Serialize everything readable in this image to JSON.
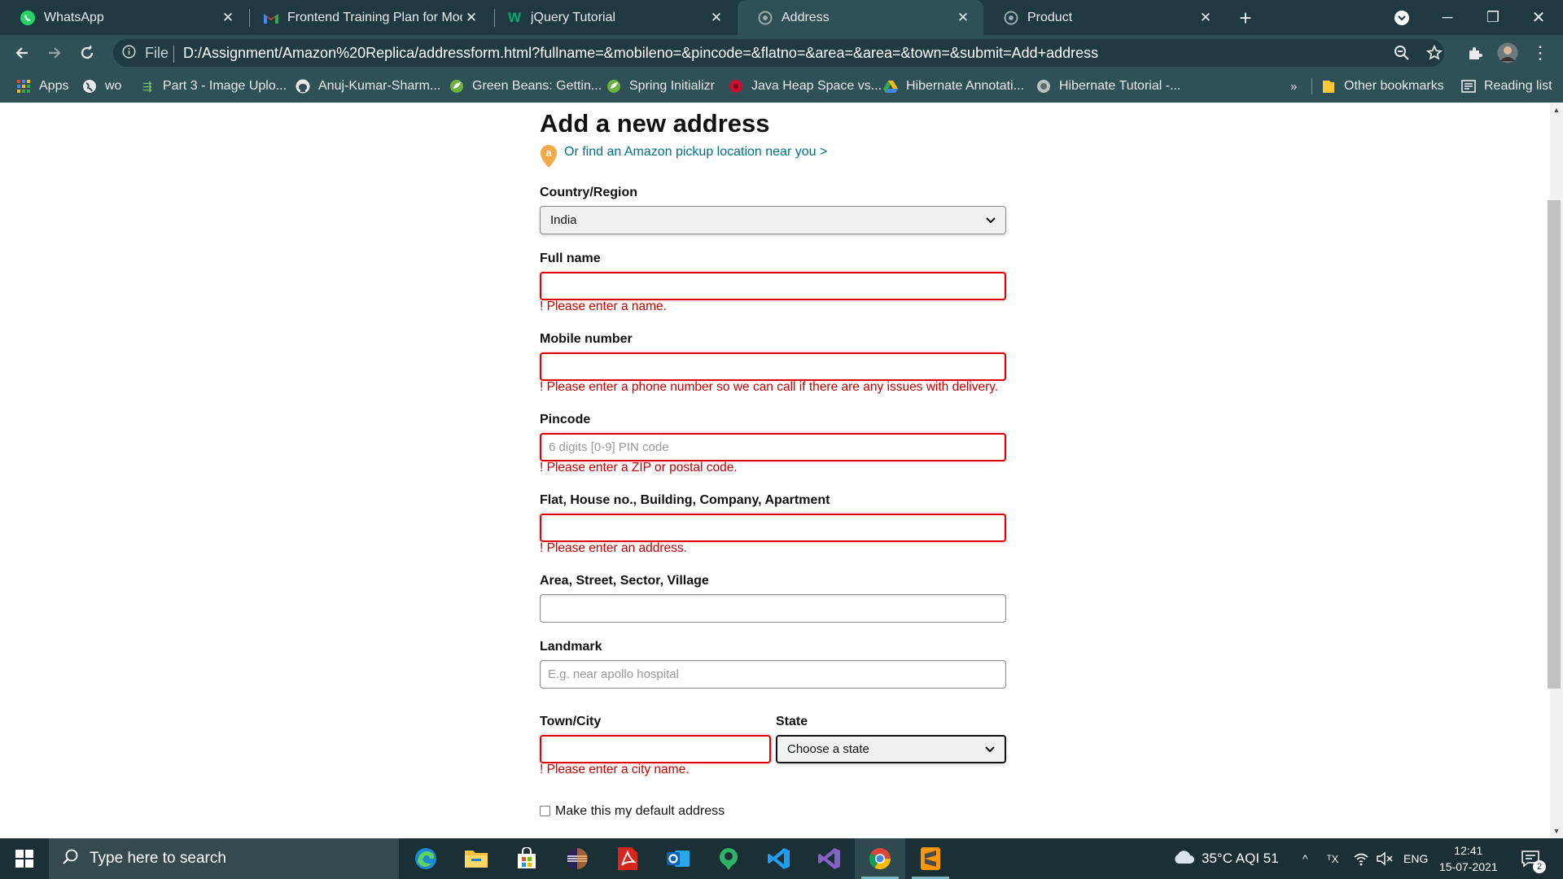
{
  "browser": {
    "tabs": [
      {
        "title": "WhatsApp",
        "icon": "whatsapp-icon"
      },
      {
        "title": "Frontend Training Plan for Modul",
        "icon": "gmail-icon"
      },
      {
        "title": "jQuery Tutorial",
        "icon": "w3schools-icon"
      },
      {
        "title": "Address",
        "icon": "page-icon",
        "active": true
      },
      {
        "title": "Product",
        "icon": "page-icon"
      }
    ],
    "url_scheme_label": "File",
    "url": "D:/Assignment/Amazon%20Replica/addressform.html?fullname=&mobileno=&pincode=&flatno=&area=&area=&town=&submit=Add+address",
    "bookmarks": [
      {
        "label": "Apps",
        "icon": "apps-grid-icon"
      },
      {
        "label": "wo",
        "icon": "globe-icon"
      },
      {
        "label": "Part 3 - Image Uplo...",
        "icon": "doc-icon"
      },
      {
        "label": "Anuj-Kumar-Sharm...",
        "icon": "github-icon"
      },
      {
        "label": "Green Beans: Gettin...",
        "icon": "spring-icon"
      },
      {
        "label": "Spring Initializr",
        "icon": "spring-icon"
      },
      {
        "label": "Java Heap Space vs...",
        "icon": "red-circle-icon"
      },
      {
        "label": "Hibernate Annotati...",
        "icon": "drive-icon"
      },
      {
        "label": "Hibernate Tutorial -...",
        "icon": "globe-icon"
      }
    ],
    "more_bookmarks": "»",
    "other_bookmarks": "Other bookmarks",
    "reading_list": "Reading list"
  },
  "page": {
    "title": "Add a new address",
    "pickup_link": "Or find an Amazon pickup location near you >",
    "country_label": "Country/Region",
    "country_value": "India",
    "fullname_label": "Full name",
    "fullname_value": "",
    "fullname_error": "! Please enter a name.",
    "mobile_label": "Mobile number",
    "mobile_value": "",
    "mobile_error": "! Please enter a phone number so we can call if there are any issues with delivery.",
    "pincode_label": "Pincode",
    "pincode_placeholder": "6 digits [0-9] PIN code",
    "pincode_error": "! Please enter a ZIP or postal code.",
    "flat_label": "Flat, House no., Building, Company, Apartment",
    "flat_value": "",
    "flat_error": "! Please enter an address.",
    "area_label": "Area, Street, Sector, Village",
    "area_value": "",
    "landmark_label": "Landmark",
    "landmark_placeholder": "E.g. near apollo hospital",
    "town_label": "Town/City",
    "town_value": "",
    "town_error": "! Please enter a city name.",
    "state_label": "State",
    "state_value": "Choose a state",
    "default_checkbox_label": "Make this my default address",
    "default_checked": false
  },
  "taskbar": {
    "search_placeholder": "Type here to search",
    "weather": "35°C  AQI 51",
    "language": "ENG",
    "time": "12:41",
    "date": "15-07-2021",
    "notification_count": "2",
    "apps": [
      "edge-icon",
      "file-explorer-icon",
      "store-icon",
      "eclipse-icon",
      "acrobat-icon",
      "outlook-icon",
      "maps-icon",
      "vscode-icon",
      "visual-studio-icon",
      "chrome-icon",
      "sublime-icon"
    ]
  },
  "colors": {
    "titlebar": "#1e3a40",
    "toolbar": "#2f5057",
    "taskbar": "#1a3034",
    "error": "#c40000",
    "link": "#007185",
    "amazon_orange": "#f3a847"
  }
}
